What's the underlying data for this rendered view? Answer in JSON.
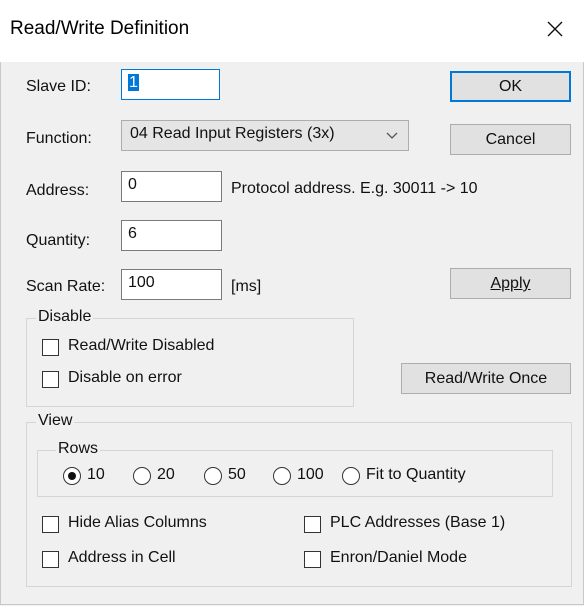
{
  "window": {
    "title": "Read/Write Definition"
  },
  "fields": {
    "slave_id": {
      "label": "Slave ID:",
      "value": "1"
    },
    "function": {
      "label": "Function:",
      "value": "04 Read Input Registers (3x)"
    },
    "address": {
      "label": "Address:",
      "value": "0",
      "hint": "Protocol address. E.g. 30011 -> 10"
    },
    "quantity": {
      "label": "Quantity:",
      "value": "6"
    },
    "scan_rate": {
      "label": "Scan Rate:",
      "value": "100",
      "unit": "[ms]"
    }
  },
  "buttons": {
    "ok": "OK",
    "cancel": "Cancel",
    "apply": "Apply",
    "rw_once": "Read/Write Once"
  },
  "disable_group": {
    "title": "Disable",
    "rw_disabled": "Read/Write Disabled",
    "disable_on_error": "Disable on error"
  },
  "view_group": {
    "title": "View",
    "rows_title": "Rows",
    "rows_options": [
      "10",
      "20",
      "50",
      "100",
      "Fit to Quantity"
    ],
    "rows_selected": "10",
    "hide_alias": "Hide Alias Columns",
    "plc_addresses": "PLC Addresses (Base 1)",
    "address_in_cell": "Address in Cell",
    "enron_mode": "Enron/Daniel Mode"
  },
  "colors": {
    "accent": "#0078d7",
    "window_bg": "#f0f0f0",
    "button_bg": "#e1e1e1"
  }
}
